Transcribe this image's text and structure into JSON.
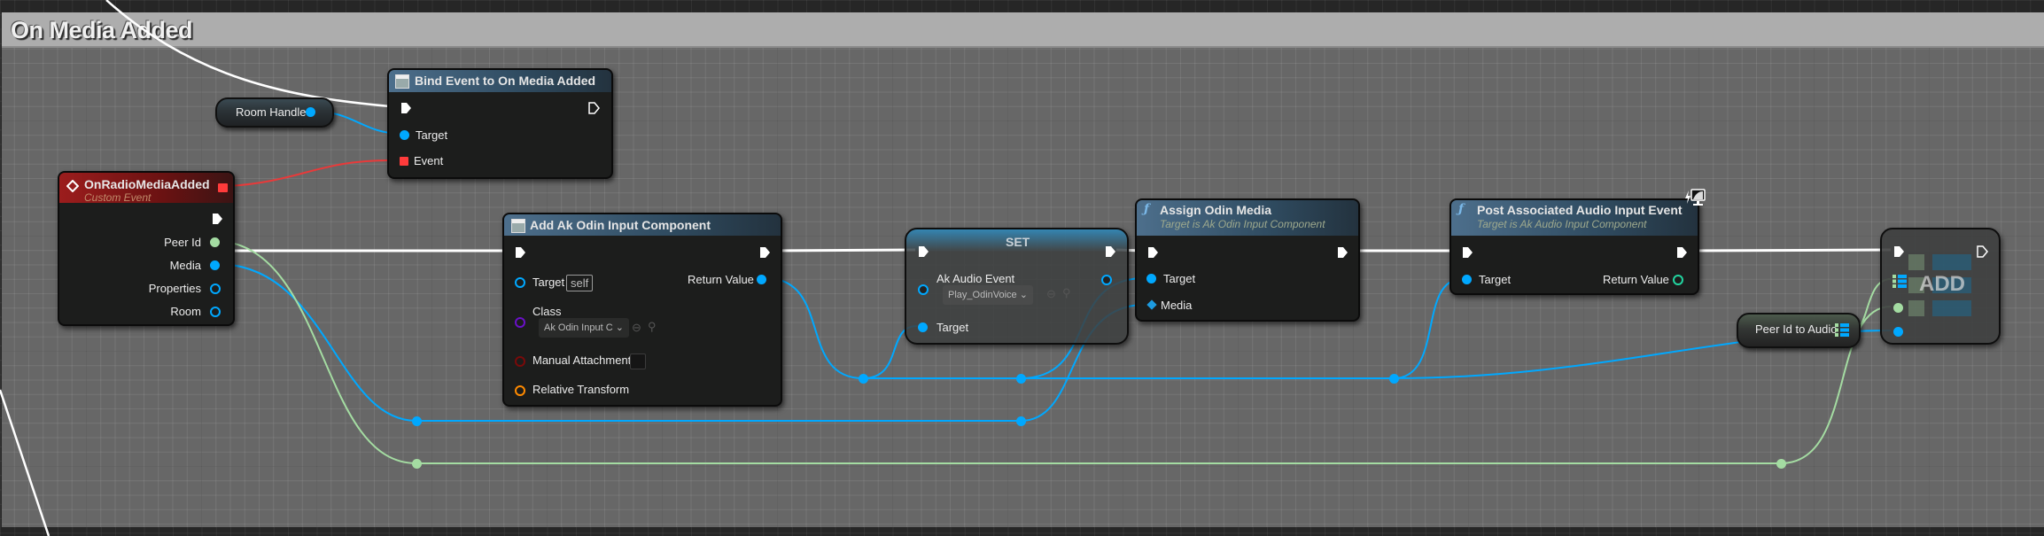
{
  "comment": {
    "title": "On Media Added"
  },
  "colors": {
    "exec_wire": "#ffffff",
    "object_wire": "#00a8ff",
    "string_wire": "#a4dca2",
    "delegate_wire": "#e83a3a"
  },
  "nodes": {
    "custom_event": {
      "title": "OnRadioMediaAdded",
      "subtitle": "Custom Event",
      "icon": "event-diamond-icon",
      "outputs": [
        "Peer Id",
        "Media",
        "Properties",
        "Room"
      ]
    },
    "room_handle": {
      "label": "Room Handle"
    },
    "bind_event": {
      "title": "Bind Event to On Media Added",
      "icon": "function-box-icon",
      "inputs": [
        "Target",
        "Event"
      ]
    },
    "add_component": {
      "title": "Add Ak Odin Input Component",
      "icon": "function-box-icon",
      "target_label": "Target",
      "target_value": "self",
      "class_label": "Class",
      "class_value": "Ak Odin Input C",
      "manual_attachment_label": "Manual Attachment",
      "manual_attachment_checked": false,
      "relative_transform_label": "Relative Transform",
      "return_label": "Return Value"
    },
    "set_node": {
      "title": "SET",
      "ak_audio_event_label": "Ak Audio Event",
      "ak_audio_event_value": "Play_OdinVoice",
      "target_label": "Target"
    },
    "assign_media": {
      "title": "Assign Odin Media",
      "subtitle": "Target is Ak Odin Input Component",
      "icon": "function-f-icon",
      "inputs": [
        "Target",
        "Media"
      ]
    },
    "post_event": {
      "title": "Post Associated Audio Input Event",
      "subtitle": "Target is Ak Audio Input Component",
      "icon": "function-f-icon",
      "target_label": "Target",
      "return_label": "Return Value",
      "badge_icon": "client-only-monitor-icon"
    },
    "peer_map": {
      "label": "Peer Id to Audio"
    },
    "map_add": {
      "title": "ADD"
    }
  }
}
